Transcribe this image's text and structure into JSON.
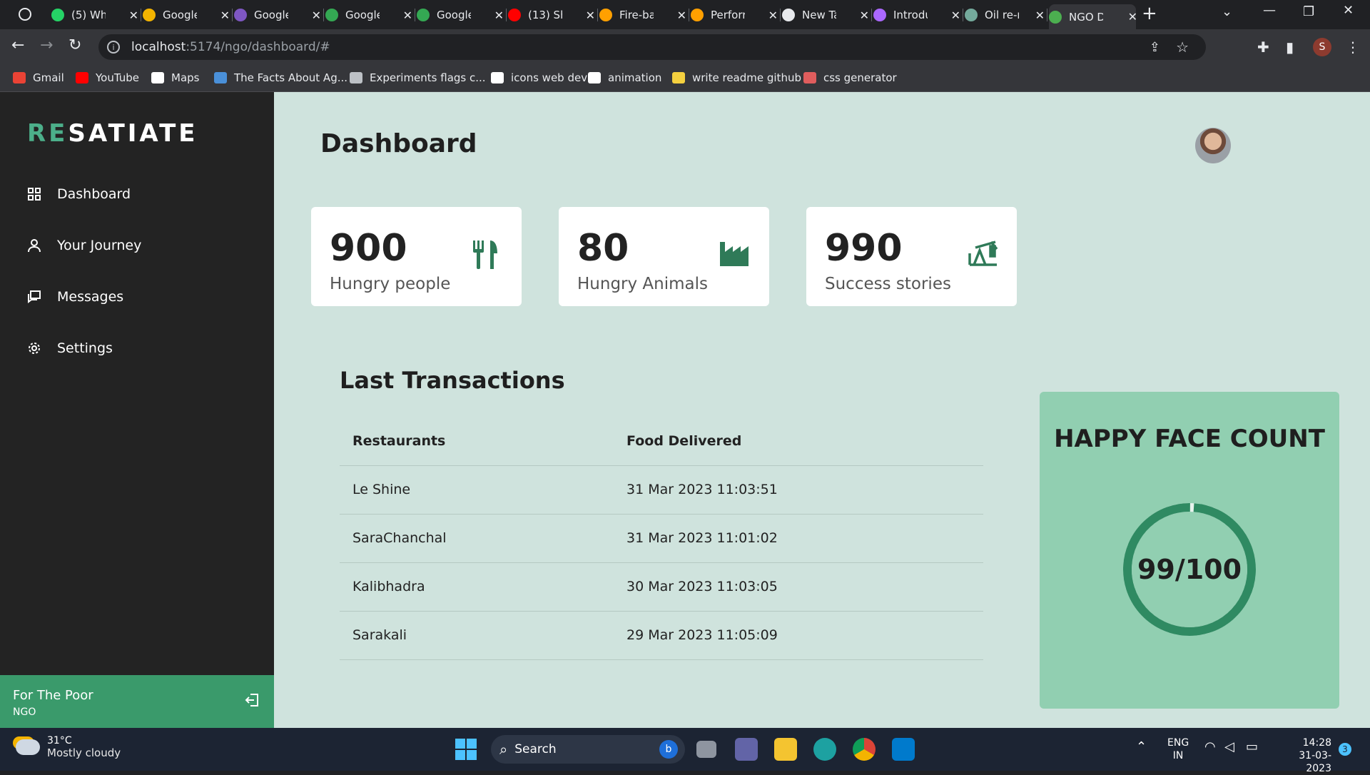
{
  "browser": {
    "tabs": [
      {
        "label": "(5) Wh",
        "color": "#25d366"
      },
      {
        "label": "Google",
        "color": "#f4b400"
      },
      {
        "label": "Google",
        "color": "#7e57c2"
      },
      {
        "label": "Google",
        "color": "#34a853"
      },
      {
        "label": "Google",
        "color": "#34a853"
      },
      {
        "label": "(13) Sh",
        "color": "#ff0000"
      },
      {
        "label": "Fire-ba",
        "color": "#ffa000"
      },
      {
        "label": "Perforr",
        "color": "#ffa000"
      },
      {
        "label": "New Ta",
        "color": "#e8eaed"
      },
      {
        "label": "Introdu",
        "color": "#ab68ff"
      },
      {
        "label": "Oil re-r",
        "color": "#74aa9c"
      },
      {
        "label": "NGO D",
        "color": "#4caf50"
      }
    ],
    "url_host": "localhost",
    "url_path": ":5174/ngo/dashboard/#",
    "profile_initial": "S",
    "bookmarks": [
      "Gmail",
      "YouTube",
      "Maps",
      "The Facts About Ag...",
      "Experiments flags c...",
      "icons web dev",
      "animation",
      "write readme github",
      "css generator"
    ]
  },
  "sidebar": {
    "brand_first": "RE",
    "brand_rest": "SATIATE",
    "items": [
      {
        "label": "Dashboard",
        "icon": "grid-icon"
      },
      {
        "label": "Your Journey",
        "icon": "user-icon"
      },
      {
        "label": "Messages",
        "icon": "message-icon"
      },
      {
        "label": "Settings",
        "icon": "gear-icon"
      }
    ],
    "footer_title": "For The Poor",
    "footer_sub": "NGO"
  },
  "main": {
    "title": "Dashboard",
    "cards": [
      {
        "value": "900",
        "label": "Hungry people",
        "icon": "utensils-icon"
      },
      {
        "value": "80",
        "label": "Hungry Animals",
        "icon": "industry-icon"
      },
      {
        "value": "990",
        "label": "Success stories",
        "icon": "oil-pump-icon"
      }
    ],
    "transactions_title": "Last Transactions",
    "table_headers": [
      "Restaurants",
      "Food Delivered"
    ],
    "rows": [
      [
        "Le Shine",
        "31 Mar 2023 11:03:51"
      ],
      [
        "SaraChanchal",
        "31 Mar 2023 11:01:02"
      ],
      [
        "Kalibhadra",
        "30 Mar 2023 11:03:05"
      ],
      [
        "Sarakali",
        "29 Mar 2023 11:05:09"
      ]
    ],
    "happy_title": "HAPPY FACE COUNT",
    "happy_value": "99/100",
    "happy_progress": 0.99,
    "accent": "#3a9a6b"
  },
  "taskbar": {
    "temp": "31°C",
    "weather": "Mostly cloudy",
    "search": "Search",
    "lang1": "ENG",
    "lang2": "IN",
    "time": "14:28",
    "date": "31-03-2023",
    "notif": "3"
  }
}
